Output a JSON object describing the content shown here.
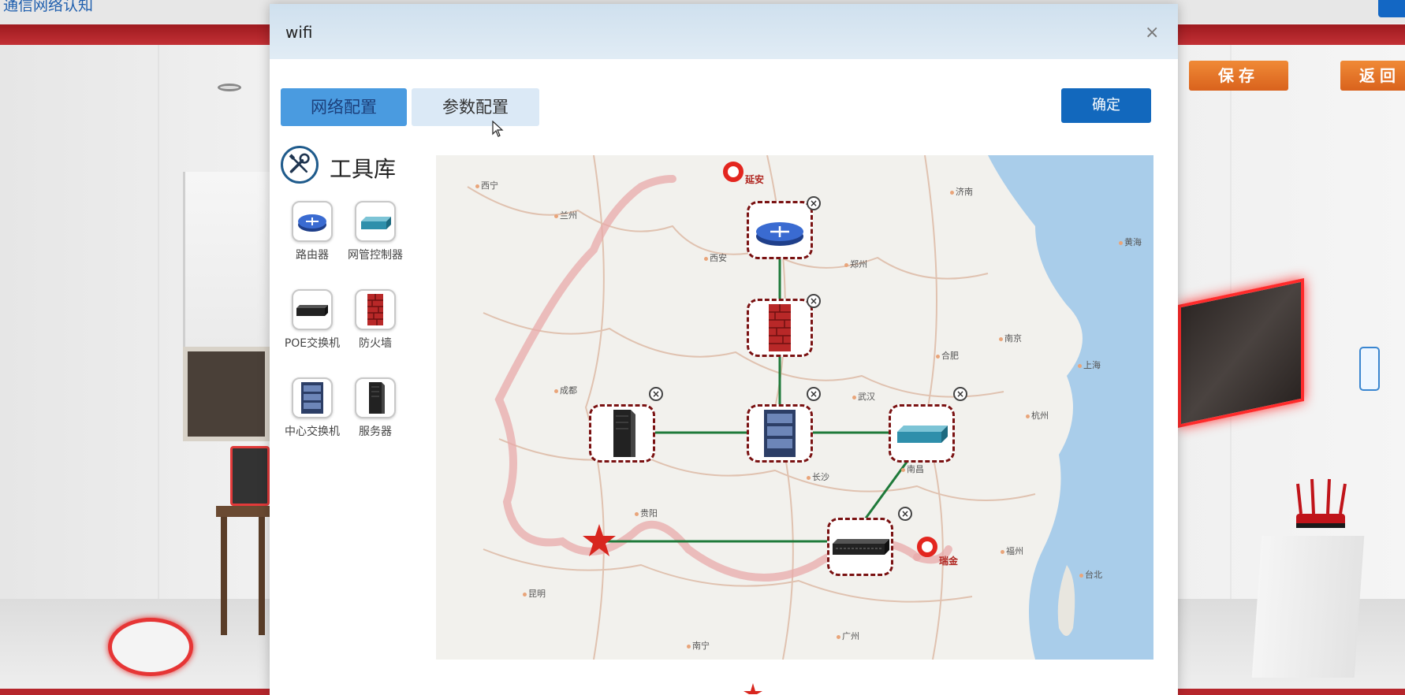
{
  "background": {
    "app_title": "通信网络认知",
    "save_label": "保存",
    "back_label": "返回"
  },
  "dialog": {
    "title": "wifi",
    "close_symbol": "×",
    "tabs": [
      {
        "label": "网络配置",
        "active": true
      },
      {
        "label": "参数配置",
        "active": false
      }
    ],
    "confirm_label": "确定"
  },
  "toolbox": {
    "title": "工具库",
    "items": [
      {
        "label": "路由器",
        "icon": "router-icon"
      },
      {
        "label": "网管控制器",
        "icon": "network-controller-icon"
      },
      {
        "label": "POE交换机",
        "icon": "poe-switch-icon"
      },
      {
        "label": "防火墙",
        "icon": "firewall-icon"
      },
      {
        "label": "中心交换机",
        "icon": "core-switch-icon"
      },
      {
        "label": "服务器",
        "icon": "server-icon"
      }
    ]
  },
  "map": {
    "cities": [
      "西宁",
      "兰州",
      "西安",
      "郑州",
      "济南",
      "黄海",
      "南京",
      "合肥",
      "上海",
      "成都",
      "武汉",
      "杭州",
      "长沙",
      "南昌",
      "贵阳",
      "福州",
      "昆明",
      "台北",
      "南宁",
      "广州"
    ],
    "pins": [
      "延安",
      "瑞金"
    ],
    "nodes": [
      "router",
      "firewall",
      "core-switch",
      "server",
      "network-controller",
      "poe-switch"
    ],
    "colors": {
      "link": "#1f7a3a",
      "node_border": "#7a1212",
      "route": "#e8a9a9",
      "pin": "#e3261f",
      "star": "#d8261e"
    }
  }
}
